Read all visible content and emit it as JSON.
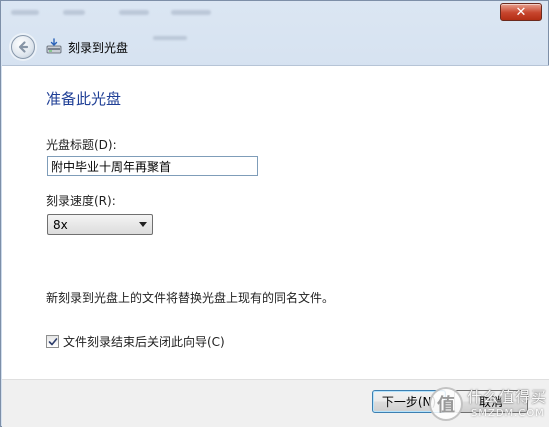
{
  "window": {
    "title": "刻录到光盘",
    "close_glyph": "✕"
  },
  "page": {
    "heading": "准备此光盘"
  },
  "disc_title": {
    "label": "光盘标题(D):",
    "value": "附中毕业十周年再聚首"
  },
  "burn_speed": {
    "label": "刻录速度(R):",
    "selected": "8x"
  },
  "info": {
    "text": "新刻录到光盘上的文件将替换光盘上现有的同名文件。"
  },
  "close_wizard": {
    "label": "文件刻录结束后关闭此向导(C)",
    "checked": true
  },
  "footer": {
    "next_label": "下一步(N)",
    "cancel_label": "取消"
  },
  "watermark": {
    "logo_glyph": "值",
    "main": "什么值得买",
    "sub": "SMZDM.COM"
  },
  "colors": {
    "heading": "#1f3f96",
    "primary_button_border": "#3c7fb1",
    "close_button": "#c7452d"
  }
}
